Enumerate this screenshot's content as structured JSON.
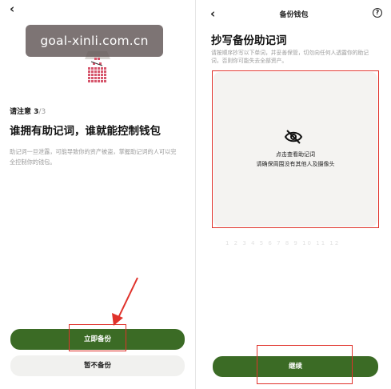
{
  "watermark": "goal-xinli.com.cn",
  "left": {
    "back_glyph": "‹",
    "notice_label": "请注意 3",
    "notice_total": "/3",
    "headline": "谁拥有助记词，谁就能控制钱包",
    "description": "助记词一旦泄露，可能导致你的资产被盗，掌握助记词的人可以完全控制你的钱包。",
    "primary_button": "立即备份",
    "secondary_button": "暂不备份"
  },
  "right": {
    "back_glyph": "‹",
    "nav_title": "备份钱包",
    "help_glyph": "?",
    "title": "抄写备份助记词",
    "description": "请按顺序抄写以下单词，并妥善保管，切勿向任何人透露你的助记词，否则你可能失去全部资产。",
    "reveal_line1": "点击查看助记词",
    "reveal_line2": "请确保周围没有其他人及摄像头",
    "faint_text": "1 2 3 4 5 6 7 8 9 10 11 12",
    "continue_button": "继续"
  },
  "colors": {
    "accent_green": "#3b6b25",
    "highlight_red": "#e0322b",
    "panel_bg": "#f4f3f1"
  },
  "icons": [
    "chevron-left-icon",
    "help-circle-icon",
    "eye-off-icon",
    "lock-illustration",
    "arrow-annotation"
  ]
}
